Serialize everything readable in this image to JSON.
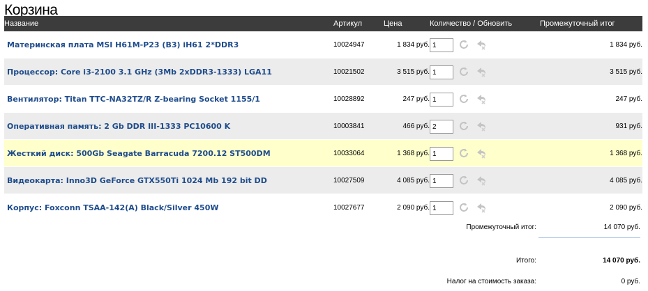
{
  "page": {
    "title": "Корзина"
  },
  "table": {
    "headers": {
      "name": "Название",
      "sku": "Артикул",
      "price": "Цена",
      "qty": "Количество / Обновить",
      "subtotal": "Промежуточный итог"
    },
    "rows": [
      {
        "name": "Материнская плата MSI H61M-P23 (B3) iH61 2*DDR3",
        "sku": "10024947",
        "price": "1 834 руб.",
        "qty": "1",
        "subtotal": "1 834 руб."
      },
      {
        "name": "Процессор: Core i3-2100 3.1 GHz (3Mb 2xDDR3-1333) LGA11",
        "sku": "10021502",
        "price": "3 515 руб.",
        "qty": "1",
        "subtotal": "3 515 руб."
      },
      {
        "name": "Вентилятор: Titan TTC-NA32TZ/R Z-bearing Socket 1155/1",
        "sku": "10028892",
        "price": "247 руб.",
        "qty": "1",
        "subtotal": "247 руб."
      },
      {
        "name": "Оперативная память: 2 Gb DDR III-1333 PC10600 K",
        "sku": "10003841",
        "price": "466 руб.",
        "qty": "2",
        "subtotal": "931 руб."
      },
      {
        "name": "Жесткий диск: 500Gb Seagate Barracuda 7200.12 ST500DM",
        "sku": "10033064",
        "price": "1 368 руб.",
        "qty": "1",
        "subtotal": "1 368 руб."
      },
      {
        "name": "Видеокарта: Inno3D GeForce GTX550Ti 1024 Mb 192 bit DD",
        "sku": "10027509",
        "price": "4 085 руб.",
        "qty": "1",
        "subtotal": "4 085 руб."
      },
      {
        "name": "Корпус: Foxconn TSAA-142(A) Black/Silver 450W",
        "sku": "10027677",
        "price": "2 090 руб.",
        "qty": "1",
        "subtotal": "2 090 руб."
      }
    ]
  },
  "summary": {
    "subtotal_label": "Промежуточный итог:",
    "subtotal_value": "14 070 руб.",
    "total_label": "Итого:",
    "total_value": "14 070 руб.",
    "tax_label": "Налог на стоимость заказа:",
    "tax_value": "0 руб."
  },
  "icons": {
    "refresh": "refresh-icon",
    "remove": "remove-icon"
  },
  "colors": {
    "header_bg": "#3c3c3c",
    "alt_row_bg": "#ececec",
    "highlight_row_bg": "#ffffcc",
    "link": "#1f4c8c"
  }
}
